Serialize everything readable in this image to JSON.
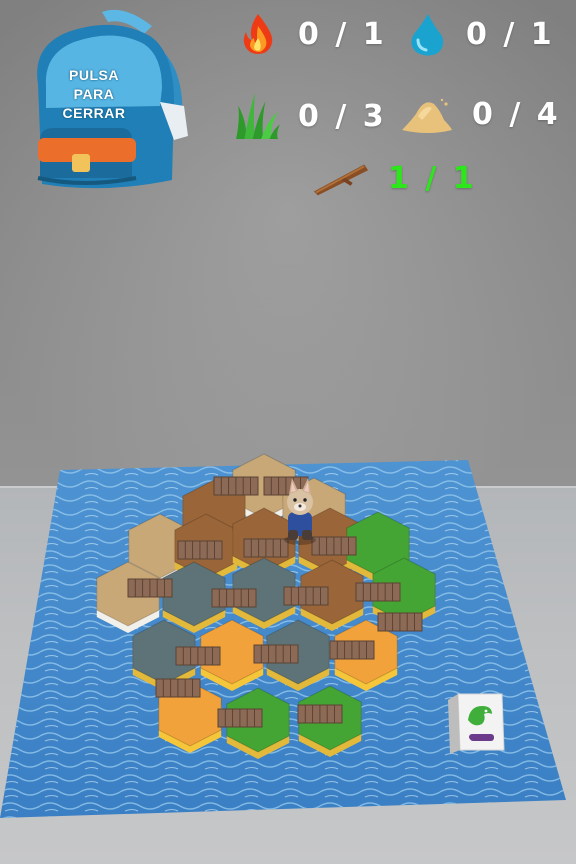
{
  "hud": {
    "backpack": {
      "label": "PULSA\nPARA\nCERRAR",
      "icon": "backpack-icon"
    },
    "resources": [
      {
        "name": "fire",
        "icon": "fire-icon",
        "count": "0 / 1",
        "collected": 0,
        "required": 1
      },
      {
        "name": "water",
        "icon": "water-drop-icon",
        "count": "0 / 1",
        "collected": 0,
        "required": 1
      },
      {
        "name": "grass",
        "icon": "grass-icon",
        "count": "0 / 3",
        "collected": 0,
        "required": 3
      },
      {
        "name": "sand",
        "icon": "sand-pile-icon",
        "count": "0 / 4",
        "collected": 0,
        "required": 4
      },
      {
        "name": "wood",
        "icon": "stick-icon",
        "count": "1 / 1",
        "collected": 1,
        "required": 1,
        "complete": true
      }
    ],
    "colors": {
      "count_text": "#ffffff",
      "count_complete": "#2ee61c"
    }
  },
  "scene": {
    "board": {
      "tile_types": [
        "wood",
        "sand",
        "grass",
        "stone",
        "lava"
      ],
      "colors": {
        "water": "#3f86c9",
        "wood": "#9a6538",
        "sand": "#c9a877",
        "grass": "#44a534",
        "stone": "#5d7378",
        "lava": "#f2a23a"
      }
    },
    "character": {
      "icon": "fox-character-icon"
    },
    "die": {
      "icon": "dinosaur-die-icon"
    }
  }
}
